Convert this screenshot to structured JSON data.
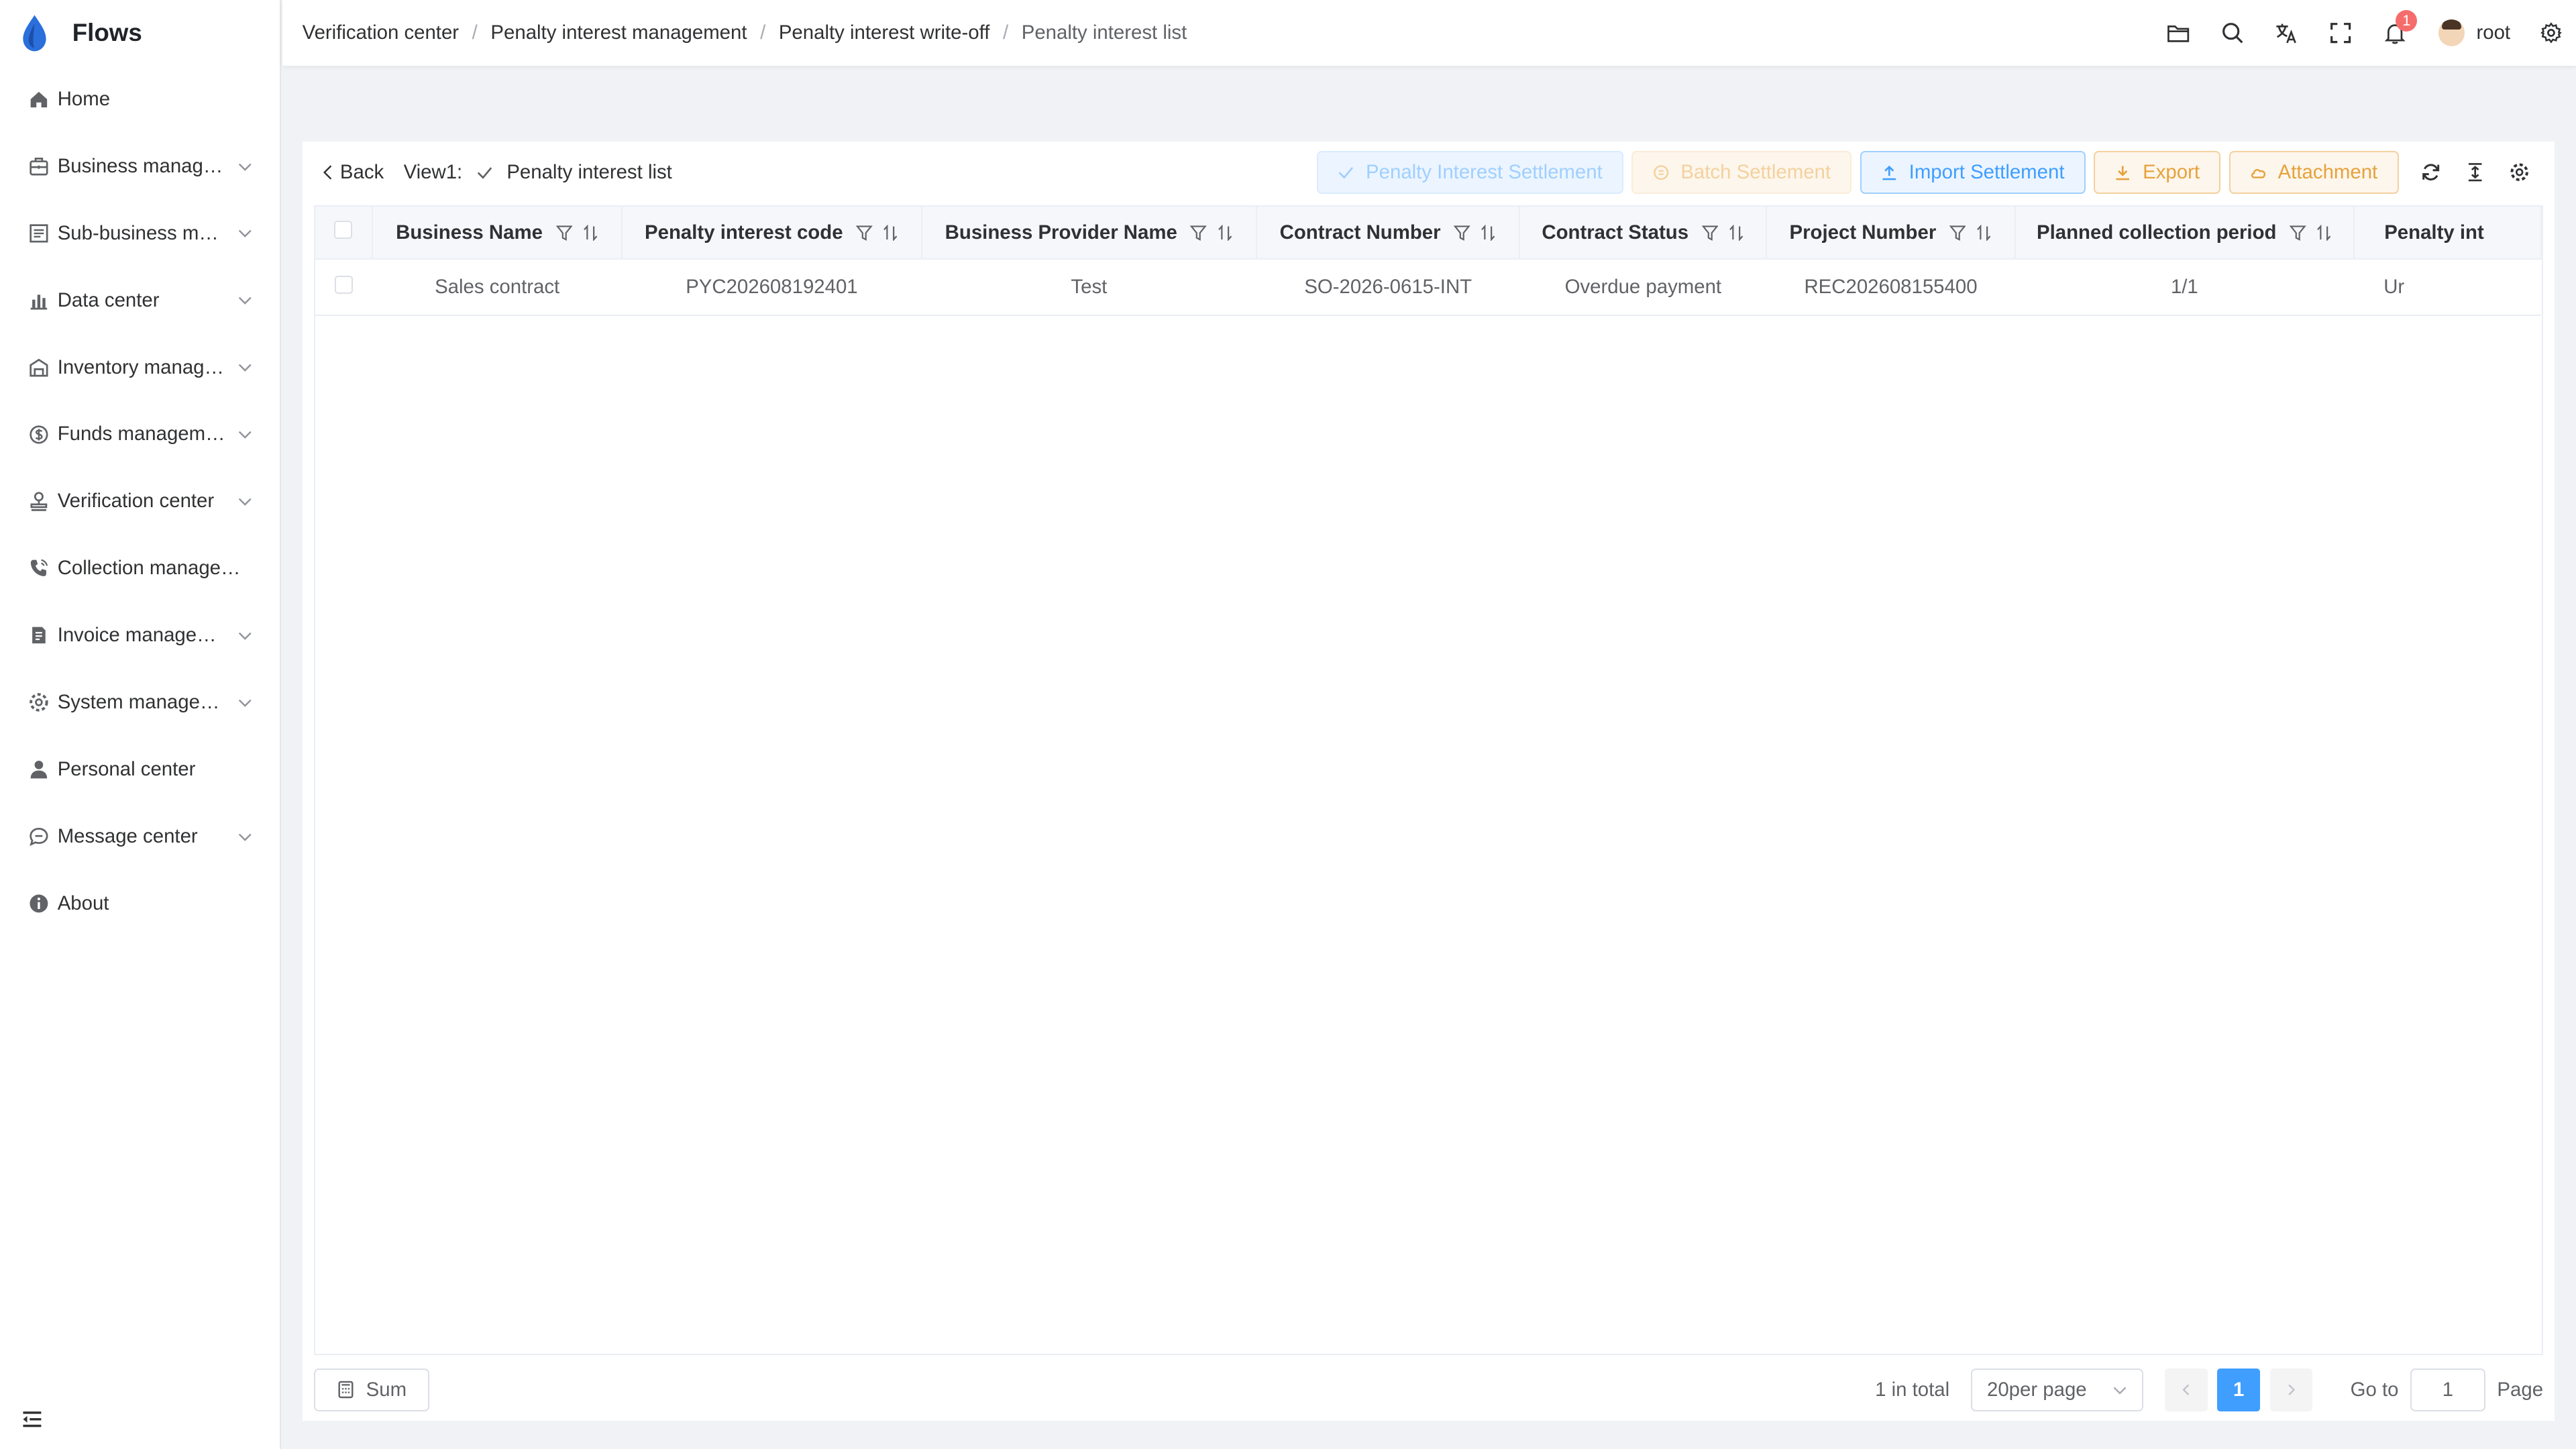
{
  "app": {
    "title": "Flows"
  },
  "sidebar": {
    "items": [
      {
        "label": "Home",
        "icon": "home-icon",
        "expandable": false
      },
      {
        "label": "Business management",
        "icon": "briefcase-icon",
        "expandable": true
      },
      {
        "label": "Sub-business management",
        "icon": "document-icon",
        "expandable": true
      },
      {
        "label": "Data center",
        "icon": "bar-chart-icon",
        "expandable": true
      },
      {
        "label": "Inventory management",
        "icon": "warehouse-icon",
        "expandable": true
      },
      {
        "label": "Funds management",
        "icon": "money-icon",
        "expandable": true
      },
      {
        "label": "Verification center",
        "icon": "stamp-icon",
        "expandable": true
      },
      {
        "label": "Collection management",
        "icon": "phone-icon",
        "expandable": false
      },
      {
        "label": "Invoice management",
        "icon": "invoice-icon",
        "expandable": true
      },
      {
        "label": "System management",
        "icon": "settings-icon",
        "expandable": true
      },
      {
        "label": "Personal center",
        "icon": "user-icon",
        "expandable": false
      },
      {
        "label": "Message center",
        "icon": "chat-icon",
        "expandable": true
      },
      {
        "label": "About",
        "icon": "info-icon",
        "expandable": false
      }
    ]
  },
  "breadcrumb": [
    "Verification center",
    "Penalty interest management",
    "Penalty interest write-off",
    "Penalty interest list"
  ],
  "header": {
    "notification_count": "1",
    "username": "root"
  },
  "toolbar": {
    "back_label": "Back",
    "view_label": "View1:",
    "view_name": "Penalty interest list",
    "buttons": {
      "settlement": "Penalty Interest Settlement",
      "batch": "Batch Settlement",
      "import": "Import Settlement",
      "export": "Export",
      "attachment": "Attachment"
    }
  },
  "table": {
    "columns": [
      "Business Name",
      "Penalty interest code",
      "Business Provider Name",
      "Contract Number",
      "Contract Status",
      "Project Number",
      "Planned collection period",
      "Penalty int"
    ],
    "rows": [
      [
        "Sales contract",
        "PYC202608192401",
        "Test",
        "SO-2026-0615-INT",
        "Overdue payment",
        "REC202608155400",
        "1/1",
        "Ur"
      ]
    ]
  },
  "footer": {
    "sum_label": "Sum",
    "total_text": "1 in total",
    "page_size": "20per page",
    "current_page": "1",
    "goto_label": "Go to",
    "goto_value": "1",
    "page_label": "Page"
  },
  "colors": {
    "primary": "#409eff",
    "warning": "#e6a23c",
    "danger": "#f56c6c"
  }
}
